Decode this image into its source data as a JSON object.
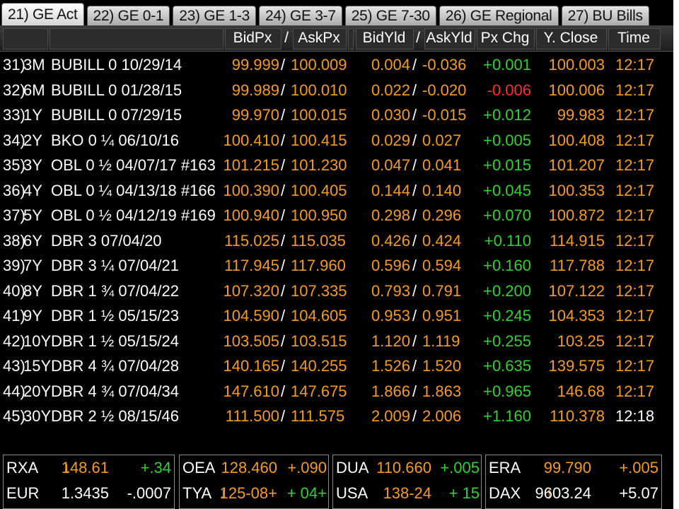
{
  "tabs": [
    {
      "label": "21) GE Act"
    },
    {
      "label": "22) GE 0-1"
    },
    {
      "label": "23) GE 1-3"
    },
    {
      "label": "24) GE 3-7"
    },
    {
      "label": "25) GE 7-30"
    },
    {
      "label": "26) GE Regional"
    },
    {
      "label": "27) BU Bills"
    }
  ],
  "headers": {
    "bid_px": "BidPx",
    "slash": "/",
    "ask_px": "AskPx",
    "bid_yld": "BidYld",
    "ask_yld": "AskYld",
    "px_chg": "Px Chg",
    "y_close": "Y. Close",
    "time": "Time"
  },
  "rows": [
    {
      "idx": "31)",
      "term": "3M",
      "security": "BUBILL 0 10/29/14",
      "bid": "99.999",
      "ask": "100.009",
      "bid_yld": "0.004",
      "ask_yld": "-0.036",
      "chg": "+0.001",
      "close": "100.003",
      "time": "12:17"
    },
    {
      "idx": "32)",
      "term": "6M",
      "security": "BUBILL 0 01/28/15",
      "bid": "99.989",
      "ask": "100.010",
      "bid_yld": "0.022",
      "ask_yld": "-0.020",
      "chg": "-0.006",
      "close": "100.006",
      "time": "12:17"
    },
    {
      "idx": "33)",
      "term": "1Y",
      "security": "BUBILL 0 07/29/15",
      "bid": "99.970",
      "ask": "100.015",
      "bid_yld": "0.030",
      "ask_yld": "-0.015",
      "chg": "+0.012",
      "close": "99.983",
      "time": "12:17"
    },
    {
      "idx": "34)",
      "term": "2Y",
      "security": "BKO 0 ¼ 06/10/16",
      "bid": "100.410",
      "ask": "100.415",
      "bid_yld": "0.029",
      "ask_yld": "0.027",
      "chg": "+0.005",
      "close": "100.408",
      "time": "12:17"
    },
    {
      "idx": "35)",
      "term": "3Y",
      "security": "OBL 0 ½ 04/07/17 #163",
      "bid": "101.215",
      "ask": "101.230",
      "bid_yld": "0.047",
      "ask_yld": "0.041",
      "chg": "+0.015",
      "close": "101.207",
      "time": "12:17"
    },
    {
      "idx": "36)",
      "term": "4Y",
      "security": "OBL 0 ¼ 04/13/18 #166",
      "bid": "100.390",
      "ask": "100.405",
      "bid_yld": "0.144",
      "ask_yld": "0.140",
      "chg": "+0.045",
      "close": "100.353",
      "time": "12:17"
    },
    {
      "idx": "37)",
      "term": "5Y",
      "security": "OBL 0 ½ 04/12/19 #169",
      "bid": "100.940",
      "ask": "100.950",
      "bid_yld": "0.298",
      "ask_yld": "0.296",
      "chg": "+0.070",
      "close": "100.872",
      "time": "12:17"
    },
    {
      "idx": "38)",
      "term": "6Y",
      "security": "DBR 3 07/04/20",
      "bid": "115.025",
      "ask": "115.035",
      "bid_yld": "0.426",
      "ask_yld": "0.424",
      "chg": "+0.110",
      "close": "114.915",
      "time": "12:17"
    },
    {
      "idx": "39)",
      "term": "7Y",
      "security": "DBR 3 ¼ 07/04/21",
      "bid": "117.945",
      "ask": "117.960",
      "bid_yld": "0.596",
      "ask_yld": "0.594",
      "chg": "+0.160",
      "close": "117.788",
      "time": "12:17"
    },
    {
      "idx": "40)",
      "term": "8Y",
      "security": "DBR 1 ¾ 07/04/22",
      "bid": "107.320",
      "ask": "107.335",
      "bid_yld": "0.793",
      "ask_yld": "0.791",
      "chg": "+0.200",
      "close": "107.122",
      "time": "12:17"
    },
    {
      "idx": "41)",
      "term": "9Y",
      "security": "DBR 1 ½ 05/15/23",
      "bid": "104.590",
      "ask": "104.605",
      "bid_yld": "0.953",
      "ask_yld": "0.951",
      "chg": "+0.245",
      "close": "104.353",
      "time": "12:17"
    },
    {
      "idx": "42)",
      "term": "10Y",
      "security": "DBR 1 ½ 05/15/24",
      "bid": "103.505",
      "ask": "103.515",
      "bid_yld": "1.120",
      "ask_yld": "1.119",
      "chg": "+0.255",
      "close": "103.25",
      "time": "12:17"
    },
    {
      "idx": "43)",
      "term": "15Y",
      "security": "DBR 4 ¾ 07/04/28",
      "bid": "140.165",
      "ask": "140.255",
      "bid_yld": "1.526",
      "ask_yld": "1.520",
      "chg": "+0.635",
      "close": "139.575",
      "time": "12:17"
    },
    {
      "idx": "44)",
      "term": "20Y",
      "security": "DBR 4 ¾ 07/04/34",
      "bid": "147.610",
      "ask": "147.675",
      "bid_yld": "1.866",
      "ask_yld": "1.863",
      "chg": "+0.965",
      "close": "146.68",
      "time": "12:17"
    },
    {
      "idx": "45)",
      "term": "30Y",
      "security": "DBR 2 ½ 08/15/46",
      "bid": "111.500",
      "ask": "111.575",
      "bid_yld": "2.009",
      "ask_yld": "2.006",
      "chg": "+1.160",
      "close": "110.378",
      "time": "12:18"
    }
  ],
  "panels": [
    [
      {
        "label": "RXA",
        "arrow": "↓",
        "value": "148.61",
        "change": "+.34",
        "change_color": "#2fd12f"
      },
      {
        "label": "EUR",
        "arrow": "",
        "value": "1.3435",
        "change": "-.0007",
        "change_color": "#ffffff"
      }
    ],
    [
      {
        "label": "OEA",
        "arrow": "",
        "value": "128.460",
        "change": "+.090",
        "change_color": "#f59a23"
      },
      {
        "label": "TYA",
        "arrow": "↓",
        "value": "125-08+",
        "change": "+ 04+",
        "change_color": "#2fd12f"
      }
    ],
    [
      {
        "label": "DUA",
        "arrow": "",
        "value": "110.660",
        "change": "+.005",
        "change_color": "#2fd12f"
      },
      {
        "label": "USA",
        "arrow": "",
        "value": "138-24",
        "change": "+ 15",
        "change_color": "#2fd12f"
      }
    ],
    [
      {
        "label": "ERA",
        "arrow": "",
        "value": "99.790",
        "change": "+.005",
        "change_color": "#f59a23"
      },
      {
        "label": "DAX",
        "arrow": "↑",
        "value": "9603.24",
        "change": "+5.07",
        "change_color": "#ffffff"
      }
    ]
  ],
  "colors": {
    "orange": "#f59a23",
    "green": "#2fd12f",
    "red": "#ff2a2a"
  }
}
